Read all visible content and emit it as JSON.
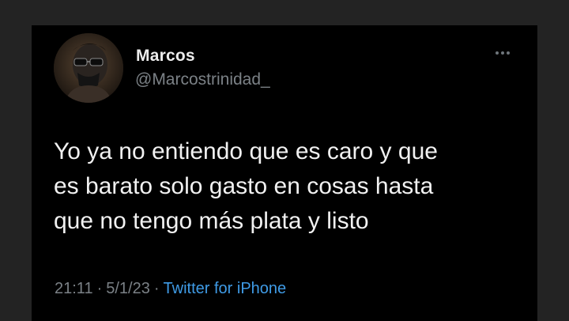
{
  "tweet": {
    "author": {
      "display_name": "Marcos",
      "handle": "@Marcostrinidad_",
      "avatar_icon": "user-avatar"
    },
    "text_lines": [
      "Yo ya no entiendo que es caro y que",
      "es barato solo gasto en cosas hasta",
      "que no tengo más plata y listo"
    ],
    "time": "21:11",
    "date": "5/1/23",
    "separator": "·",
    "source": "Twitter for iPhone",
    "more_icon": "more-options-icon"
  },
  "colors": {
    "background": "#232323",
    "card": "#000000",
    "text": "#f1f1f1",
    "muted": "#7b8186",
    "link": "#3f9be6"
  }
}
